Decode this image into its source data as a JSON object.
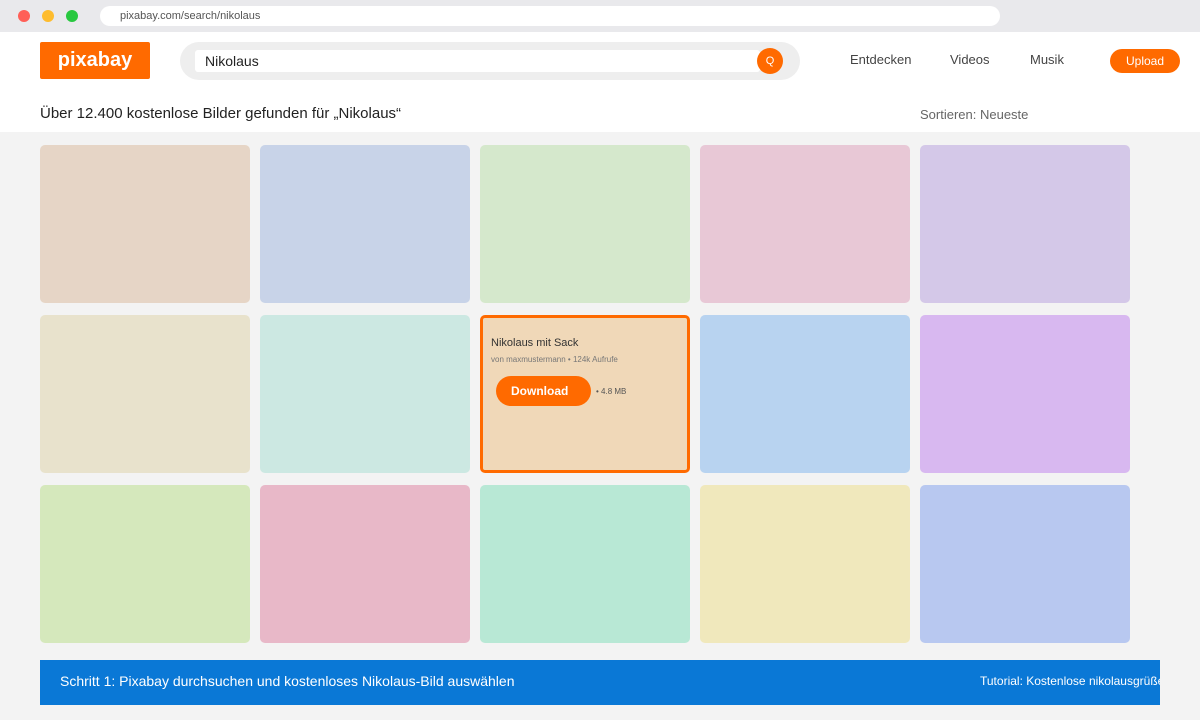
{
  "browser": {
    "url": "pixabay.com/search/nikolaus"
  },
  "header": {
    "logo": "pixabay",
    "search_value": "Nikolaus",
    "search_icon": "Q",
    "nav": [
      "Entdecken",
      "Videos",
      "Musik"
    ],
    "upload_label": "Upload"
  },
  "results": {
    "title": "Über 12.400 kostenlose Bilder gefunden für „Nikolaus“",
    "sort": "Sortieren: Neueste"
  },
  "grid": {
    "tile_colors": [
      "#e6d5c6",
      "#c8d3e8",
      "#d5e8cc",
      "#e8c8d6",
      "#d4c8e8",
      "#e8e2cc",
      "#cce8e2",
      "#f0d8b8",
      "#b8d3f0",
      "#d8b8f0",
      "#d5e8bc",
      "#e8b8c8",
      "#b8e8d5",
      "#f0e8bc",
      "#b8c8f0"
    ],
    "selected_index": 7,
    "selected": {
      "title": "Nikolaus mit Sack",
      "meta": "von maxmustermann • 124k Aufrufe",
      "download_label": "Download",
      "size": "• 4.8 MB"
    }
  },
  "banner": {
    "step": "Schritt 1: Pixabay durchsuchen und kostenloses Nikolaus-Bild auswählen",
    "tutorial": "Tutorial: Kostenlose nikolausgrüße für WhatsApp"
  },
  "colors": {
    "accent": "#ff6a00",
    "banner": "#0a78d6"
  }
}
